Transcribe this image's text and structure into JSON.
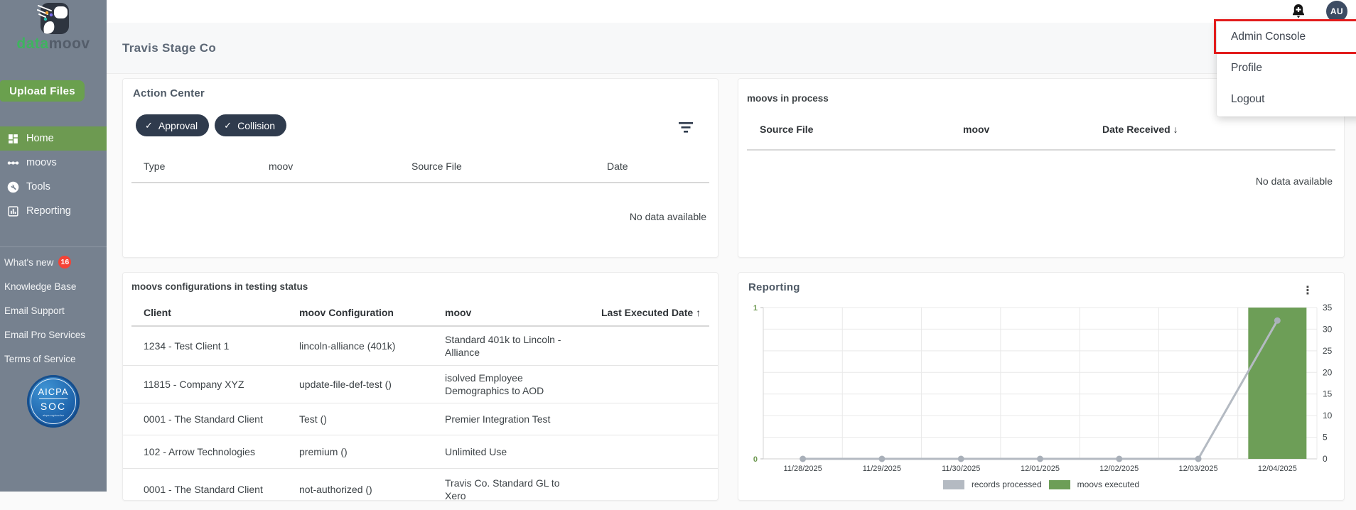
{
  "sidebar": {
    "logo": {
      "green_part": "data",
      "dark_part": "moov"
    },
    "upload_button": "Upload Files",
    "nav": [
      {
        "label": "Home",
        "active": true
      },
      {
        "label": "moovs",
        "active": false
      },
      {
        "label": "Tools",
        "active": false
      },
      {
        "label": "Reporting",
        "active": false
      }
    ],
    "links": [
      {
        "label": "What's new",
        "badge": "16"
      },
      {
        "label": "Knowledge Base"
      },
      {
        "label": "Email Support"
      },
      {
        "label": "Email Pro Services"
      },
      {
        "label": "Terms of Service"
      }
    ],
    "seal": {
      "line1": "AICPA",
      "line2": "SOC",
      "line3": "aicpa.org/soc4so"
    }
  },
  "header": {
    "company": "Travis Stage Co",
    "avatar_initials": "AU"
  },
  "user_menu": {
    "items": [
      "Admin Console",
      "Profile",
      "Logout"
    ],
    "highlighted_item": "Admin Console"
  },
  "action_center": {
    "title": "Action Center",
    "filter_chips": [
      {
        "label": "Approval",
        "check": "✓"
      },
      {
        "label": "Collision",
        "check": "✓"
      }
    ],
    "columns": [
      "Type",
      "moov",
      "Source File",
      "Date"
    ],
    "empty": "No data available"
  },
  "moovs_in_process": {
    "title": "moovs in process",
    "columns": [
      "Source File",
      "moov",
      "Date Received"
    ],
    "sort_arrow": "↓",
    "empty": "No data available"
  },
  "configs": {
    "title": "moovs configurations in testing status",
    "columns": [
      "Client",
      "moov Configuration",
      "moov",
      "Last Executed Date"
    ],
    "sort_arrow": "↑",
    "rows": [
      {
        "client": "1234 - Test Client 1",
        "configuration": "lincoln-alliance (401k)",
        "moov": "Standard 401k to Lincoln - Alliance",
        "last_executed": ""
      },
      {
        "client": "11815 - Company XYZ",
        "configuration": "update-file-def-test ()",
        "moov": "isolved Employee Demographics to AOD",
        "last_executed": ""
      },
      {
        "client": "0001 - The Standard Client",
        "configuration": "Test ()",
        "moov": "Premier Integration Test",
        "last_executed": ""
      },
      {
        "client": "102 - Arrow Technologies",
        "configuration": "premium ()",
        "moov": "Unlimited Use",
        "last_executed": ""
      },
      {
        "client": "0001 - The Standard Client",
        "configuration": "not-authorized ()",
        "moov": "Travis Co. Standard GL to Xero",
        "last_executed": ""
      }
    ]
  },
  "reporting": {
    "title": "Reporting"
  },
  "chart_data": {
    "type": "combo-bar-line",
    "x": [
      "11/28/2025",
      "11/29/2025",
      "11/30/2025",
      "12/01/2025",
      "12/02/2025",
      "12/03/2025",
      "12/04/2025"
    ],
    "series": [
      {
        "name": "records processed",
        "type": "line",
        "axis": "right",
        "color": "#b4bac2",
        "values": [
          0,
          0,
          0,
          0,
          0,
          0,
          32
        ]
      },
      {
        "name": "moovs executed",
        "type": "bar",
        "axis": "left",
        "color": "#6d9e57",
        "values": [
          0,
          0,
          0,
          0,
          0,
          0,
          1
        ]
      }
    ],
    "left_axis": {
      "range": [
        0,
        1
      ],
      "ticks": [
        0,
        1
      ],
      "color": "#6f9a52"
    },
    "right_axis": {
      "range": [
        0,
        35
      ],
      "ticks": [
        0,
        5,
        10,
        15,
        20,
        25,
        30,
        35
      ],
      "color": "#3d4347"
    },
    "grid": true,
    "legend_position": "bottom"
  },
  "colors": {
    "sidebar_bg": "#76818f",
    "accent_green": "#6aa04e",
    "active_nav_green": "#6d9a51",
    "chip_navy": "#2f3b4d",
    "annotation_red": "#e21b1b",
    "badge_red": "#f44336",
    "avatar_navy": "#3d4c63",
    "bar_green": "#6d9e57",
    "line_gray": "#b4bac2",
    "left_axis_green": "#6f9a52"
  }
}
